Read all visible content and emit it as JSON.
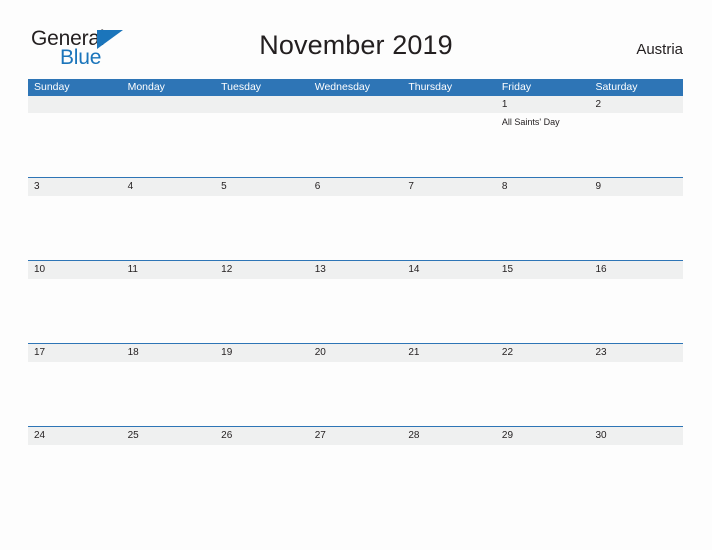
{
  "brand": {
    "name_part1": "General",
    "name_part2": "Blue",
    "triangle_icon": "blue-triangle-logo-mark",
    "color_dark": "#231f20",
    "color_blue": "#1b75bb"
  },
  "header": {
    "title": "November 2019",
    "region": "Austria"
  },
  "theme": {
    "header_blue": "#2e75b6",
    "date_band_gray": "#eff0f0",
    "page_background": "#fdfdfd",
    "text_color": "#231f20"
  },
  "calendar": {
    "weekdays": [
      "Sunday",
      "Monday",
      "Tuesday",
      "Wednesday",
      "Thursday",
      "Friday",
      "Saturday"
    ],
    "weeks": [
      {
        "rule": false,
        "days": [
          {
            "date": "",
            "events": []
          },
          {
            "date": "",
            "events": []
          },
          {
            "date": "",
            "events": []
          },
          {
            "date": "",
            "events": []
          },
          {
            "date": "",
            "events": []
          },
          {
            "date": "1",
            "events": [
              "All Saints' Day"
            ]
          },
          {
            "date": "2",
            "events": []
          }
        ]
      },
      {
        "rule": true,
        "days": [
          {
            "date": "3",
            "events": []
          },
          {
            "date": "4",
            "events": []
          },
          {
            "date": "5",
            "events": []
          },
          {
            "date": "6",
            "events": []
          },
          {
            "date": "7",
            "events": []
          },
          {
            "date": "8",
            "events": []
          },
          {
            "date": "9",
            "events": []
          }
        ]
      },
      {
        "rule": true,
        "days": [
          {
            "date": "10",
            "events": []
          },
          {
            "date": "11",
            "events": []
          },
          {
            "date": "12",
            "events": []
          },
          {
            "date": "13",
            "events": []
          },
          {
            "date": "14",
            "events": []
          },
          {
            "date": "15",
            "events": []
          },
          {
            "date": "16",
            "events": []
          }
        ]
      },
      {
        "rule": true,
        "days": [
          {
            "date": "17",
            "events": []
          },
          {
            "date": "18",
            "events": []
          },
          {
            "date": "19",
            "events": []
          },
          {
            "date": "20",
            "events": []
          },
          {
            "date": "21",
            "events": []
          },
          {
            "date": "22",
            "events": []
          },
          {
            "date": "23",
            "events": []
          }
        ]
      },
      {
        "rule": true,
        "days": [
          {
            "date": "24",
            "events": []
          },
          {
            "date": "25",
            "events": []
          },
          {
            "date": "26",
            "events": []
          },
          {
            "date": "27",
            "events": []
          },
          {
            "date": "28",
            "events": []
          },
          {
            "date": "29",
            "events": []
          },
          {
            "date": "30",
            "events": []
          }
        ]
      }
    ]
  }
}
